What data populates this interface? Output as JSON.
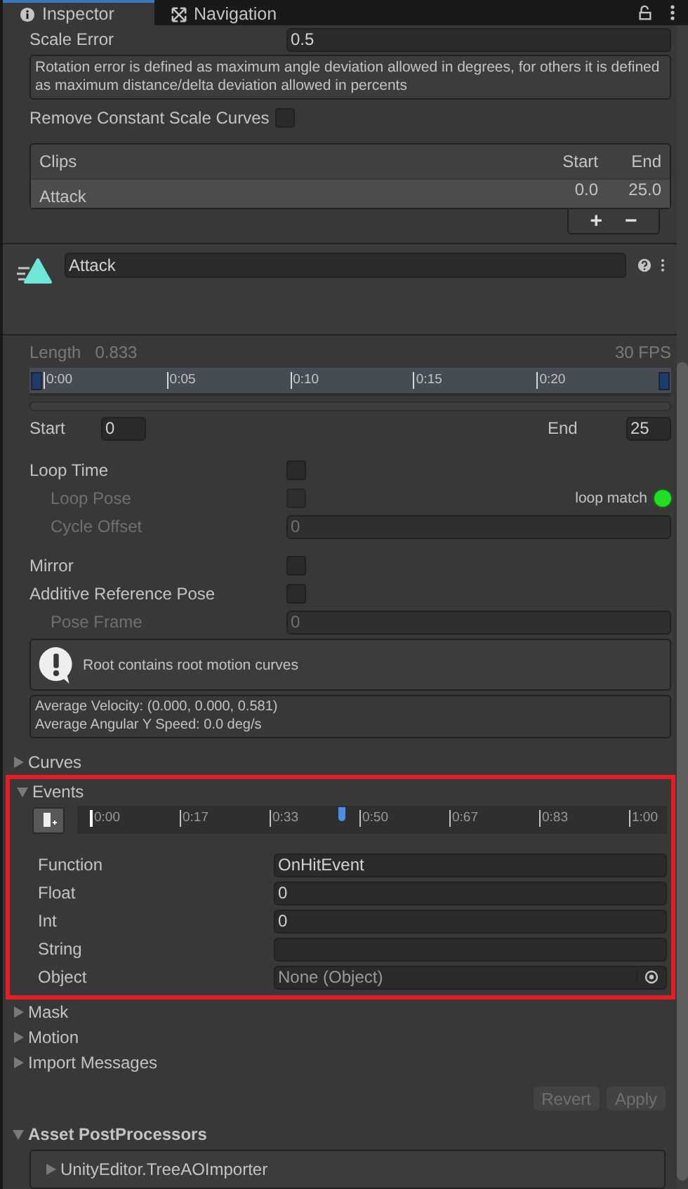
{
  "tabs": [
    {
      "label": "Inspector",
      "selected": true
    },
    {
      "label": "Navigation",
      "selected": false
    }
  ],
  "scale_error": {
    "label": "Scale Error",
    "value": "0.5"
  },
  "help_text": "Rotation error is defined as maximum angle deviation allowed in degrees, for others it is defined as maximum distance/delta deviation allowed in percents",
  "remove_constant": {
    "label": "Remove Constant Scale Curves",
    "checked": false
  },
  "clips": {
    "columns": [
      "Clips",
      "Start",
      "End"
    ],
    "rows": [
      {
        "name": "Attack",
        "start": "0.0",
        "end": "25.0",
        "selected": true
      }
    ],
    "add": "+",
    "remove": "−"
  },
  "clip_name": "Attack",
  "length": {
    "label": "Length",
    "value": "0.833",
    "fps": "30 FPS"
  },
  "timeline_labels": [
    "0:00",
    "0:05",
    "0:10",
    "0:15",
    "0:20"
  ],
  "start": {
    "label": "Start",
    "value": "0"
  },
  "end": {
    "label": "End",
    "value": "25"
  },
  "settings": [
    {
      "kind": "checkbox",
      "label": "Loop Time",
      "checked": false,
      "disabled": false,
      "children": [
        {
          "kind": "checkbox",
          "label": "Loop Pose",
          "checked": false,
          "disabled": true,
          "badge": {
            "label": "loop match",
            "color": "#22dd22"
          }
        },
        {
          "kind": "field",
          "label": "Cycle Offset",
          "value": "0",
          "disabled": true
        }
      ]
    },
    {
      "kind": "checkbox",
      "label": "Mirror",
      "checked": false,
      "disabled": false
    },
    {
      "kind": "checkbox",
      "label": "Additive Reference Pose",
      "checked": false,
      "disabled": false,
      "children": [
        {
          "kind": "field",
          "label": "Pose Frame",
          "value": "0",
          "disabled": true
        }
      ]
    }
  ],
  "warning": "Root contains root motion curves",
  "stats": [
    "Average Velocity: (0.000, 0.000, 0.581)",
    "Average Angular Y Speed: 0.0 deg/s"
  ],
  "foldouts_before": [
    {
      "label": "Curves",
      "expanded": false
    }
  ],
  "events": {
    "label": "Events",
    "expanded": true,
    "highlighted": true,
    "ticks": [
      "0:00",
      "0:17",
      "0:33",
      "0:50",
      "0:67",
      "0:83",
      "1:00"
    ],
    "marker": {
      "level": 0.46
    },
    "params": [
      {
        "kind": "text",
        "label": "Function",
        "value": "OnHitEvent"
      },
      {
        "kind": "text",
        "label": "Float",
        "value": "0"
      },
      {
        "kind": "text",
        "label": "Int",
        "value": "0"
      },
      {
        "kind": "text",
        "label": "String"
      },
      {
        "kind": "object",
        "label": "Object",
        "value": "None (Object)"
      }
    ]
  },
  "foldouts_after": [
    {
      "label": "Mask",
      "expanded": false
    },
    {
      "label": "Motion",
      "expanded": false
    },
    {
      "label": "Import Messages",
      "expanded": false
    }
  ],
  "buttons": [
    {
      "label": "Revert",
      "disabled": true
    },
    {
      "label": "Apply",
      "disabled": true
    }
  ],
  "postprocessors": {
    "label": "Asset PostProcessors",
    "expanded": true,
    "items": [
      {
        "label": "UnityEditor.TreeAOImporter",
        "expanded": false
      }
    ]
  }
}
